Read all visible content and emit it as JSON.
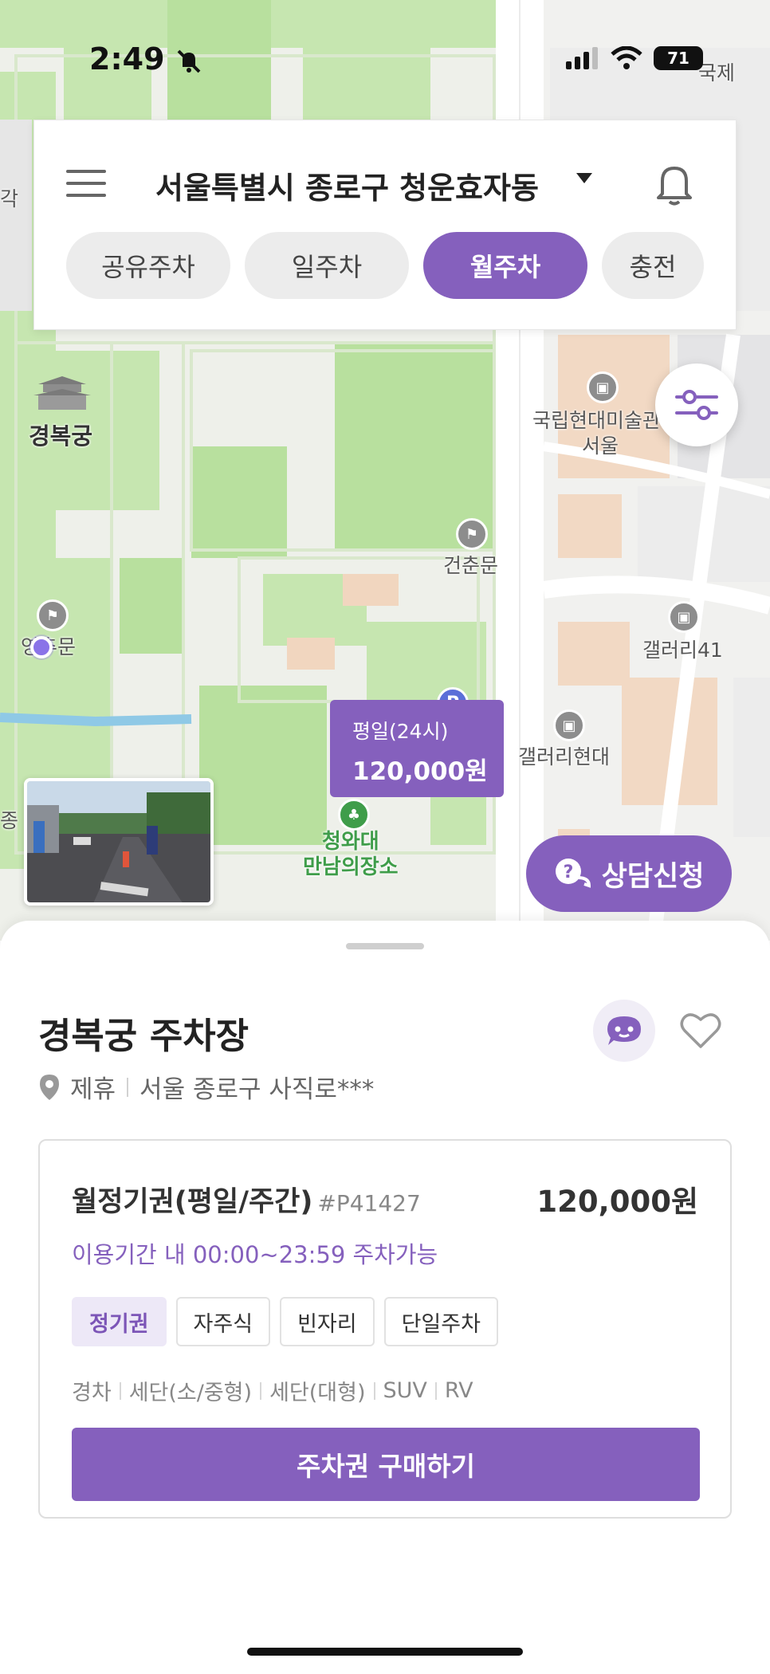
{
  "status_bar": {
    "time": "2:49",
    "battery": "71"
  },
  "header": {
    "location": "서울특별시 종로구 청운효자동",
    "tabs": [
      {
        "label": "공유주차",
        "active": false
      },
      {
        "label": "일주차",
        "active": false
      },
      {
        "label": "월주차",
        "active": true
      },
      {
        "label": "충전",
        "active": false
      }
    ]
  },
  "map": {
    "labels": {
      "gyeongbokgung": "경복궁",
      "mmca": "국립현대미술관",
      "mmca_sub": "서울",
      "geonchunmun": "건춘문",
      "gallery41": "갤러리41",
      "gallery_hyundai": "갤러리현대",
      "cheongwadae": "청와대",
      "cheongwadae_sub": "만남의장소",
      "yeongchumun": "영추문",
      "gukje": "국제",
      "gak": "각",
      "jong": "종"
    },
    "price_marker": {
      "label": "평일(24시)",
      "price": "120,000원"
    },
    "parking_pin": "P",
    "consult_button": "상담신청"
  },
  "lot": {
    "title": "경복궁 주차장",
    "tag": "제휴",
    "address": "서울 종로구 사직로***",
    "ticket": {
      "name": "월정기권(평일/주간)",
      "code": "#P41427",
      "price": "120,000원",
      "hours": "이용기간 내 00:00~23:59 주차가능",
      "chips": [
        "정기권",
        "자주식",
        "빈자리",
        "단일주차"
      ],
      "car_types": [
        "경차",
        "세단(소/중형)",
        "세단(대형)",
        "SUV",
        "RV"
      ],
      "buy_button": "주차권 구매하기"
    }
  },
  "colors": {
    "accent": "#8560bd",
    "map_green": "#a8d88c",
    "map_bg": "#f1f1ef"
  },
  "icons": [
    "menu-icon",
    "caret-down-icon",
    "bell-icon",
    "filter-icon",
    "chat-icon",
    "heart-icon",
    "location-pin-icon",
    "parking-icon"
  ]
}
